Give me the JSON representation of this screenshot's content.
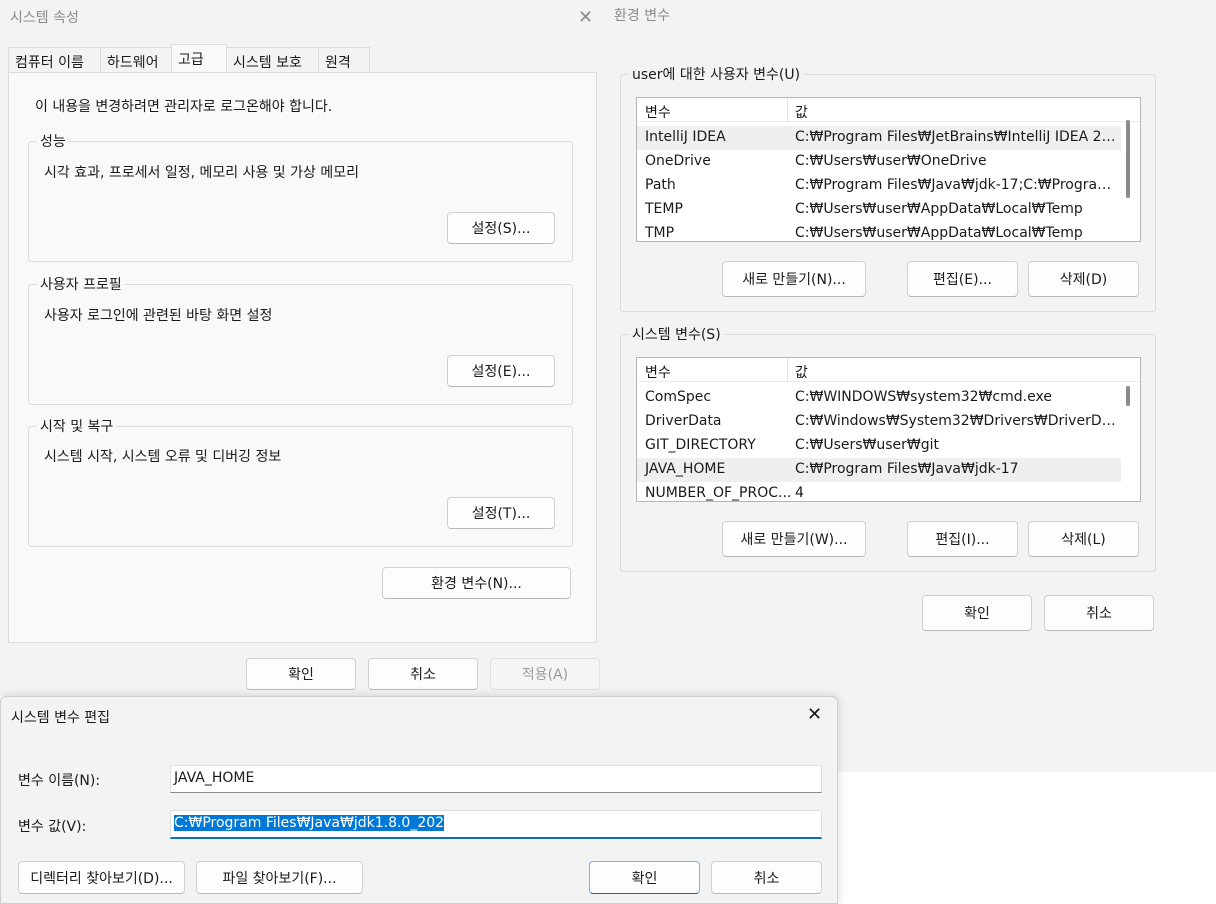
{
  "system_properties": {
    "title": "시스템 속성",
    "close_glyph": "✕",
    "tabs": [
      "컴퓨터 이름",
      "하드웨어",
      "고급",
      "시스템 보호",
      "원격"
    ],
    "active_tab": "고급",
    "admin_note": "이 내용을 변경하려면 관리자로 로그온해야 합니다.",
    "performance": {
      "title": "성능",
      "desc": "시각 효과, 프로세서 일정, 메모리 사용 및 가상 메모리",
      "button": "설정(S)..."
    },
    "user_profiles": {
      "title": "사용자 프로필",
      "desc": "사용자 로그인에 관련된 바탕 화면 설정",
      "button": "설정(E)..."
    },
    "startup_recovery": {
      "title": "시작 및 복구",
      "desc": "시스템 시작, 시스템 오류 및 디버깅 정보",
      "button": "설정(T)..."
    },
    "env_button": "환경 변수(N)...",
    "ok": "확인",
    "cancel": "취소",
    "apply": "적용(A)"
  },
  "env_vars": {
    "title": "환경 변수",
    "user_group": {
      "title": "user에 대한 사용자 변수(U)",
      "col_name": "변수",
      "col_value": "값",
      "rows": [
        {
          "name": "IntelliJ IDEA",
          "value": "C:₩Program Files₩JetBrains₩IntelliJ IDEA 202..."
        },
        {
          "name": "OneDrive",
          "value": "C:₩Users₩user₩OneDrive"
        },
        {
          "name": "Path",
          "value": "C:₩Program Files₩Java₩jdk-17;C:₩Program F..."
        },
        {
          "name": "TEMP",
          "value": "C:₩Users₩user₩AppData₩Local₩Temp"
        },
        {
          "name": "TMP",
          "value": "C:₩Users₩user₩AppData₩Local₩Temp"
        }
      ],
      "new": "새로 만들기(N)...",
      "edit": "편집(E)...",
      "delete": "삭제(D)"
    },
    "system_group": {
      "title": "시스템 변수(S)",
      "col_name": "변수",
      "col_value": "값",
      "rows": [
        {
          "name": "ComSpec",
          "value": "C:₩WINDOWS₩system32₩cmd.exe"
        },
        {
          "name": "DriverData",
          "value": "C:₩Windows₩System32₩Drivers₩DriverData"
        },
        {
          "name": "GIT_DIRECTORY",
          "value": "C:₩Users₩user₩git"
        },
        {
          "name": "JAVA_HOME",
          "value": "C:₩Program Files₩Java₩jdk-17"
        },
        {
          "name": "NUMBER_OF_PROC...",
          "value": "4"
        }
      ],
      "new": "새로 만들기(W)...",
      "edit": "편집(I)...",
      "delete": "삭제(L)"
    },
    "ok": "확인",
    "cancel": "취소"
  },
  "edit_dialog": {
    "title": "시스템 변수 편집",
    "close_glyph": "✕",
    "name_label": "변수 이름(N):",
    "name_value": "JAVA_HOME",
    "value_label": "변수 값(V):",
    "value_value": "C:₩Program Files₩Java₩jdk1.8.0_202",
    "browse_dir": "디렉터리 찾아보기(D)...",
    "browse_file": "파일 찾아보기(F)...",
    "ok": "확인",
    "cancel": "취소"
  }
}
